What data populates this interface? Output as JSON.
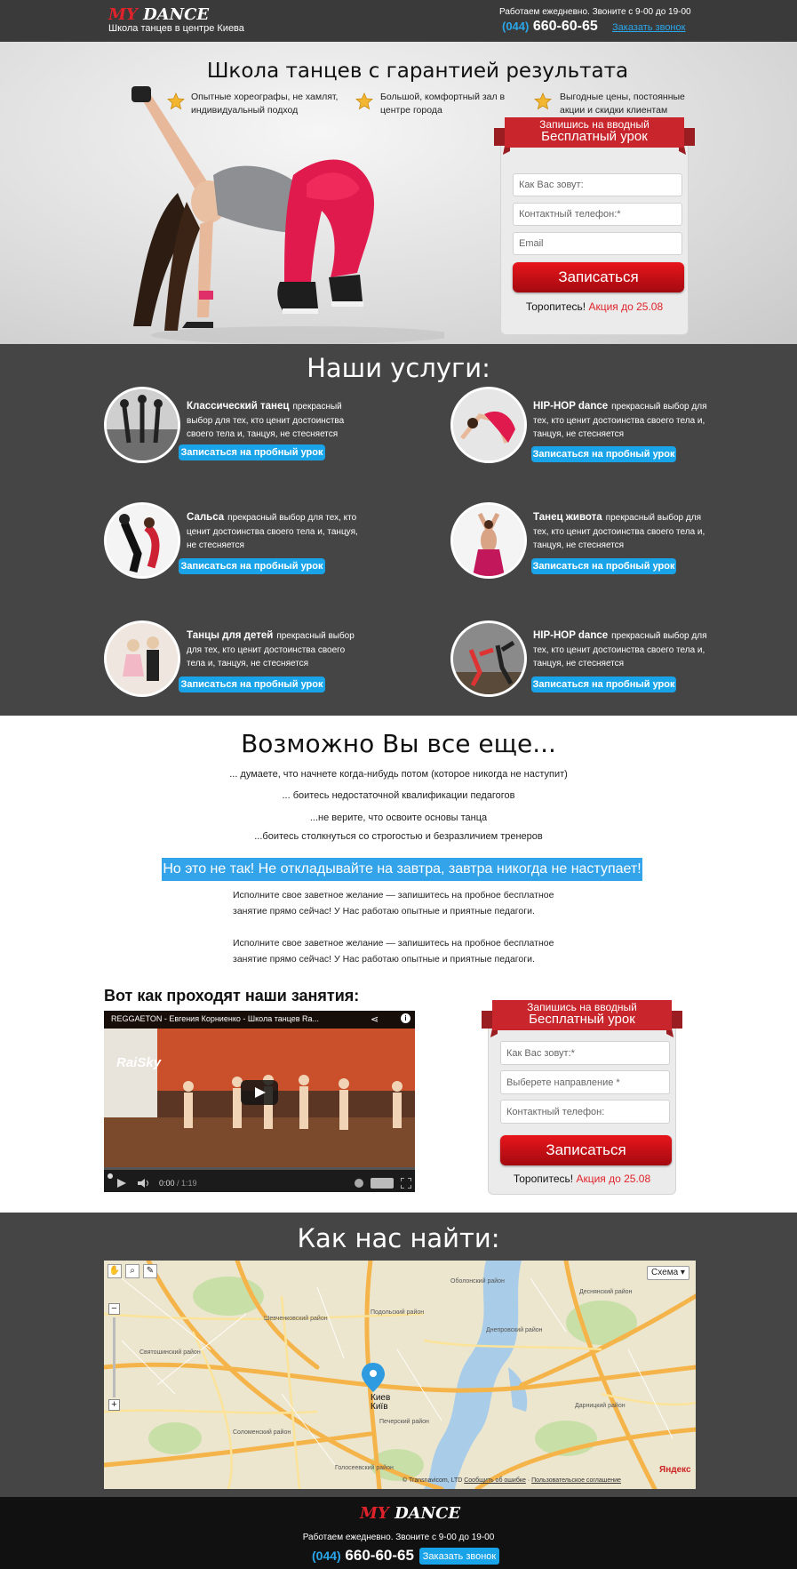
{
  "brand": {
    "logo_my": "MY",
    "logo_dance": "DANCE",
    "subtitle": "Школа танцев в центре Киева"
  },
  "contact": {
    "hours": "Работаем ежедневно. Звоните с 9-00 до 19-00",
    "phone_code": "(044)",
    "phone_number": "660-60-65",
    "callback_link": "Заказать звонок"
  },
  "hero": {
    "title": "Школа танцев с гарантией результата",
    "features": [
      "Опытные хореографы, не хамлят, индивидуальный подход",
      "Большой, комфортный зал в центре города",
      "Выгодные цены, постоянные акции и скидки клиентам"
    ]
  },
  "form_top": {
    "ribbon_line1": "Запишись на вводный",
    "ribbon_line2": "Бесплатный урок",
    "name_placeholder": "Как Вас зовут:",
    "phone_placeholder": "Контактный телефон:*",
    "email_placeholder": "Email",
    "submit": "Записаться",
    "hurry": "Торопитесь!",
    "promo": "Акция до 25.08"
  },
  "services": {
    "title": "Наши услуги:",
    "button_label": "Записаться на пробный урок",
    "items": [
      {
        "name": "Классический танец",
        "desc": "прекрасный выбор для тех, кто ценит достоинства своего тела и, танцуя, не стесняется"
      },
      {
        "name": "HIP-HOP dance",
        "desc": "прекрасный выбор для тех, кто ценит достоинства своего тела и, танцуя, не стесняется"
      },
      {
        "name": "Сальса",
        "desc": "прекрасный выбор для тех, кто ценит достоинства своего тела и, танцуя, не стесняется"
      },
      {
        "name": "Танец живота",
        "desc": "прекрасный выбор для тех, кто ценит достоинства своего тела и, танцуя, не стесняется"
      },
      {
        "name": "Танцы для детей",
        "desc": "прекрасный выбор для тех, кто ценит достоинства своего тела и, танцуя, не стесняется"
      },
      {
        "name": "HIP-HOP dance",
        "desc": "прекрасный выбор для тех, кто ценит достоинства своего тела и, танцуя, не стесняется"
      }
    ]
  },
  "maybe": {
    "title": "Возможно Вы все еще...",
    "lines": [
      "... думаете, что начнете когда-нибудь потом (которое никогда не наступит)",
      "... боитесь недостаточной квалификации педагогов",
      "...не верите, что освоите основы танца",
      "...боитесь столкнуться со строгостью и безразличием тренеров"
    ],
    "highlight": "Но это не так! Не откладывайте на завтра, завтра никогда не наступает!",
    "paragraph1": "Исполните свое заветное желание — запишитесь на пробное бесплатное занятие прямо сейчас! У Нас работаю опытные и приятные педагоги.",
    "paragraph2": "Исполните свое заветное желание — запишитесь на пробное бесплатное занятие прямо сейчас! У Нас работаю опытные и приятные педагоги."
  },
  "video": {
    "heading": "Вот как проходят наши занятия:",
    "title": "REGGAETON - Евгения Корниенко - Школа танцев Ra...",
    "time_current": "0:00",
    "time_total": "1:19",
    "studio_sign": "RaiSky"
  },
  "form_bottom": {
    "ribbon_line1": "Запишись на вводный",
    "ribbon_line2": "Бесплатный урок",
    "name_placeholder": "Как Вас зовут:*",
    "direction_placeholder": "Выберете направление *",
    "phone_placeholder": "Контактный телефон:",
    "submit": "Записаться",
    "hurry": "Торопитесь!",
    "promo": "Акция до 25.08"
  },
  "map": {
    "title": "Как нас найти:",
    "scheme_label": "Схема ▾",
    "city_label_ru": "Киев",
    "city_label_ua": "Київ",
    "districts": [
      "Шевченковский район",
      "Подольский район",
      "Оболонский район",
      "Днепровский район",
      "Соломенский район",
      "Печерский район",
      "Голосеевский район",
      "Дарницкий район",
      "Деснянский район",
      "Святошинский район"
    ],
    "yandex": "Яндекс",
    "copyright": "© Transnavicom, LTD",
    "report_link": "Сообщить об ошибке",
    "terms_link": "Пользовательское соглашение"
  },
  "footer": {
    "logo_my": "MY",
    "logo_dance": "DANCE",
    "hours": "Работаем ежедневно. Звоните с 9-00 до 19-00",
    "phone_code": "(044)",
    "phone_number": "660-60-65",
    "callback_button": "Заказать звонок"
  },
  "colors": {
    "accent_blue": "#19a3e8",
    "accent_red": "#e0232b",
    "dark_bg": "#454545",
    "header_bg": "#3a3a3a"
  }
}
